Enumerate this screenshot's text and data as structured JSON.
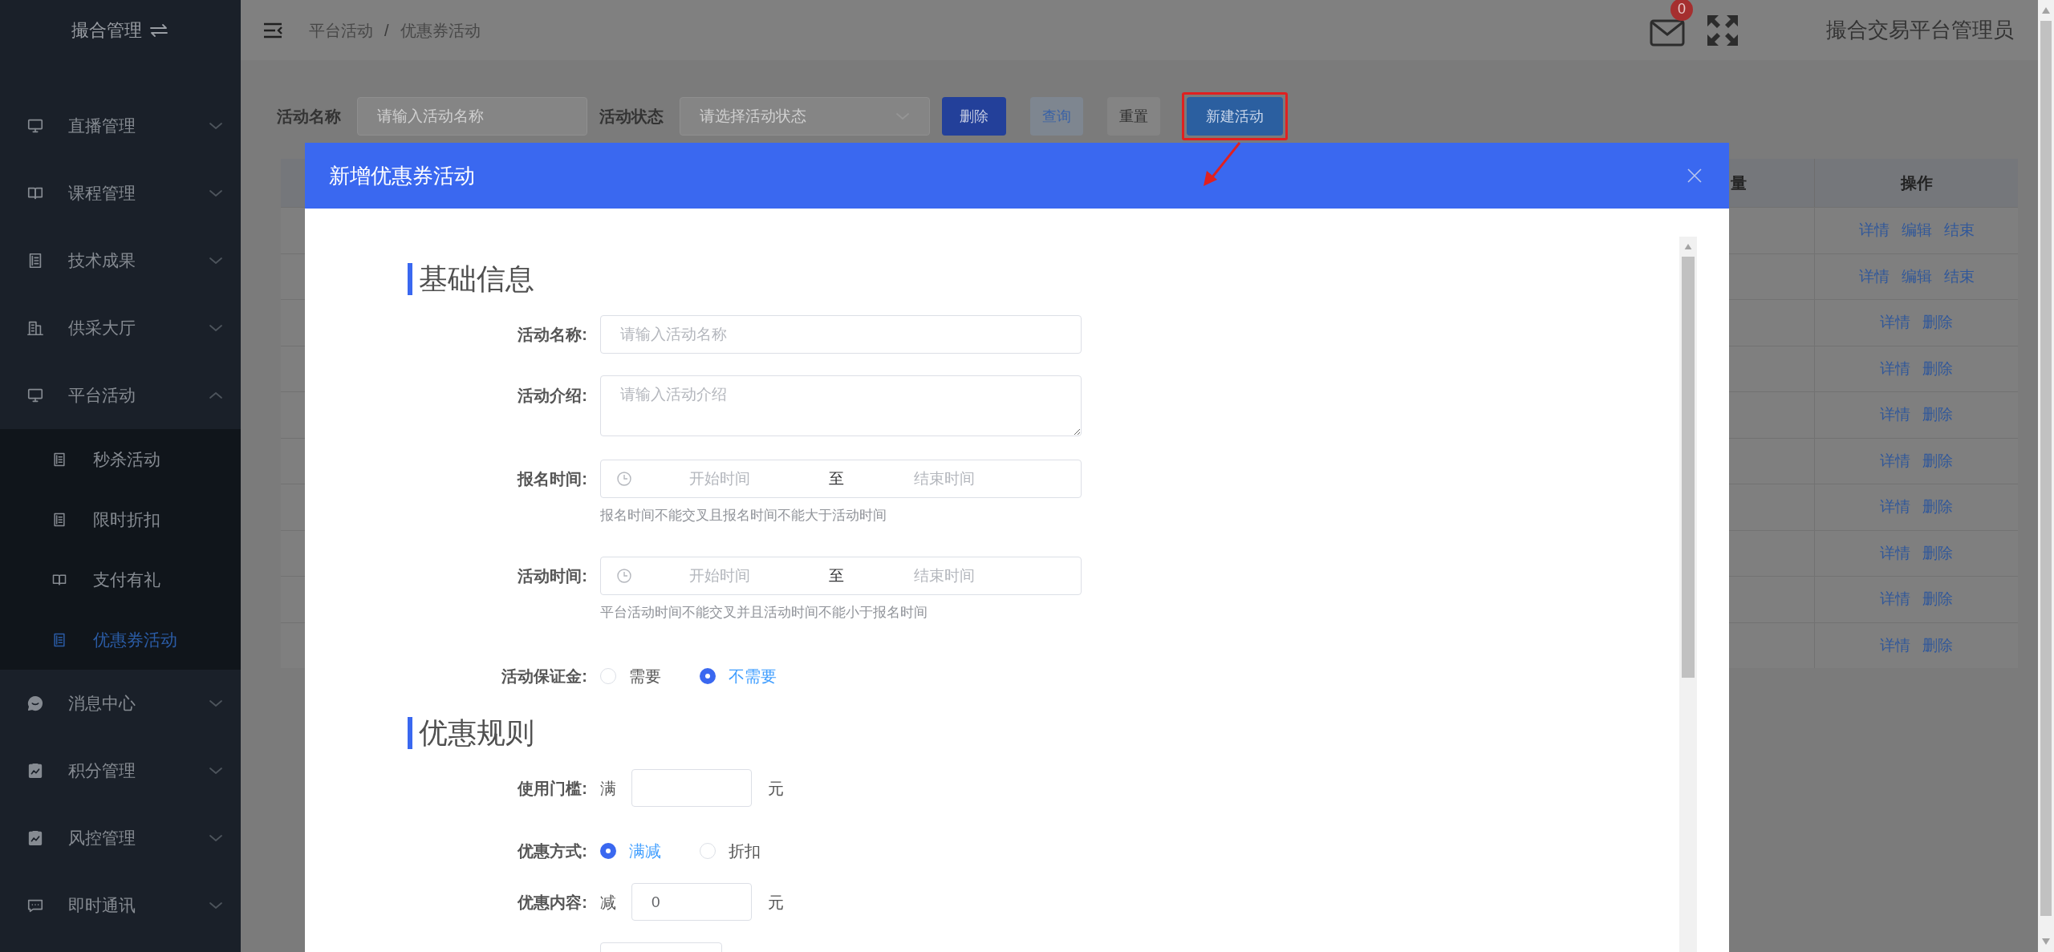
{
  "sidebar": {
    "title": "撮合管理",
    "groups": [
      {
        "label": "直播管理",
        "expanded": false
      },
      {
        "label": "课程管理",
        "expanded": false
      },
      {
        "label": "技术成果",
        "expanded": false
      },
      {
        "label": "供采大厅",
        "expanded": false
      },
      {
        "label": "平台活动",
        "expanded": true,
        "children": [
          {
            "label": "秒杀活动",
            "selected": false
          },
          {
            "label": "限时折扣",
            "selected": false
          },
          {
            "label": "支付有礼",
            "selected": false
          },
          {
            "label": "优惠券活动",
            "selected": true
          }
        ]
      },
      {
        "label": "消息中心",
        "expanded": false
      },
      {
        "label": "积分管理",
        "expanded": false
      },
      {
        "label": "风控管理",
        "expanded": false
      },
      {
        "label": "即时通讯",
        "expanded": false
      }
    ]
  },
  "header": {
    "breadcrumb": [
      "平台活动",
      "优惠券活动"
    ],
    "separator": "/",
    "mail_count": "0",
    "user_name": "撮合交易平台管理员"
  },
  "filters": [
    {
      "label": "活动名称",
      "kind": "input",
      "placeholder": "请输入活动名称"
    },
    {
      "label": "活动状态",
      "kind": "select",
      "placeholder": "请选择活动状态"
    }
  ],
  "buttons": [
    {
      "label": "删除",
      "kind": "primary",
      "highlighted": false
    },
    {
      "label": "查询",
      "kind": "light",
      "highlighted": false
    },
    {
      "label": "重置",
      "kind": "plain",
      "highlighted": false
    },
    {
      "label": "新建活动",
      "kind": "accent",
      "highlighted": true
    }
  ],
  "table": {
    "columns": [
      "量",
      "操作"
    ],
    "rows": [
      {
        "actions": [
          "详情",
          "编辑",
          "结束"
        ]
      },
      {
        "actions": [
          "详情",
          "编辑",
          "结束"
        ]
      },
      {
        "actions": [
          "详情",
          "删除"
        ]
      },
      {
        "actions": [
          "详情",
          "删除"
        ]
      },
      {
        "actions": [
          "详情",
          "删除"
        ]
      },
      {
        "actions": [
          "详情",
          "删除"
        ]
      },
      {
        "actions": [
          "详情",
          "删除"
        ]
      },
      {
        "actions": [
          "详情",
          "删除"
        ]
      },
      {
        "actions": [
          "详情",
          "删除"
        ]
      },
      {
        "actions": [
          "详情",
          "删除"
        ]
      }
    ]
  },
  "modal": {
    "title": "新增优惠券活动",
    "sections": [
      {
        "title": "基础信息",
        "fields": [
          {
            "kind": "text",
            "label": "活动名称:",
            "placeholder": "请输入活动名称"
          },
          {
            "kind": "textarea",
            "label": "活动介绍:",
            "placeholder": "请输入活动介绍"
          },
          {
            "kind": "daterange",
            "label": "报名时间:",
            "start_placeholder": "开始时间",
            "separator": "至",
            "end_placeholder": "结束时间",
            "hint": "报名时间不能交叉且报名时间不能大于活动时间"
          },
          {
            "kind": "daterange",
            "label": "活动时间:",
            "start_placeholder": "开始时间",
            "separator": "至",
            "end_placeholder": "结束时间",
            "hint": "平台活动时间不能交叉并且活动时间不能小于报名时间"
          },
          {
            "kind": "radio",
            "label": "活动保证金:",
            "options": [
              {
                "label": "需要",
                "selected": false
              },
              {
                "label": "不需要",
                "selected": true
              }
            ]
          }
        ]
      },
      {
        "title": "优惠规则",
        "fields": [
          {
            "kind": "amount",
            "label": "使用门槛:",
            "prefix": "满",
            "suffix": "元"
          },
          {
            "kind": "radio",
            "label": "优惠方式:",
            "options": [
              {
                "label": "满减",
                "selected": true
              },
              {
                "label": "折扣",
                "selected": false
              }
            ]
          },
          {
            "kind": "amount",
            "label": "优惠内容:",
            "prefix": "减",
            "value": "0",
            "suffix": "元"
          },
          {
            "kind": "cutoff"
          }
        ]
      }
    ]
  }
}
